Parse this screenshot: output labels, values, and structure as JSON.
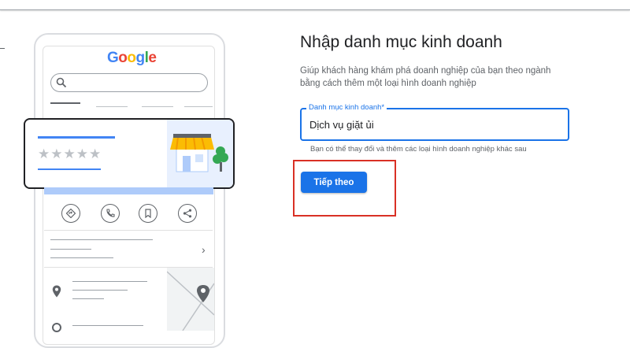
{
  "illustration": {
    "logo_letters": [
      "G",
      "o",
      "o",
      "g",
      "l",
      "e"
    ],
    "rating_stars": "★★★★★",
    "chevron": "›",
    "icons": [
      "search-icon",
      "directions-icon",
      "phone-icon",
      "bookmark-icon",
      "share-icon",
      "storefront-icon",
      "location-pin-icon",
      "clock-icon"
    ]
  },
  "form": {
    "title": "Nhập danh mục kinh doanh",
    "description": "Giúp khách hàng khám phá doanh nghiệp của bạn theo ngành bằng cách thêm một loại hình doanh nghiệp",
    "field_label": "Danh mục kinh doanh*",
    "field_value": "Dịch vụ giặt ủi",
    "hint": "Bạn có thể thay đổi và thêm các loại hình doanh nghiệp khác sau",
    "next_button": "Tiếp theo"
  },
  "colors": {
    "accent": "#1a73e8",
    "highlight_box": "#d93025",
    "google_blue": "#4285F4",
    "google_red": "#EA4335",
    "google_yellow": "#FBBC05",
    "google_green": "#34A853"
  }
}
